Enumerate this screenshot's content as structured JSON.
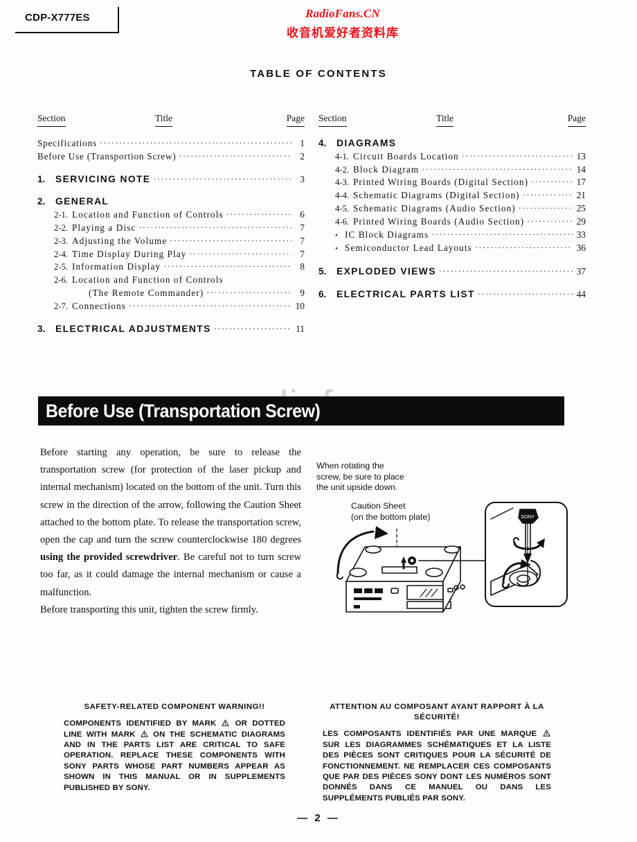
{
  "header": {
    "model": "CDP-X777ES",
    "brand_en": "RadioFans.CN",
    "brand_zh": "收音机爱好者资料库"
  },
  "toc": {
    "title": "TABLE OF CONTENTS",
    "columns": [
      {
        "headers": {
          "section": "Section",
          "title": "Title",
          "page": "Page"
        },
        "rows": [
          {
            "num": "",
            "label": "Specifications",
            "page": "1",
            "level": "plain"
          },
          {
            "num": "",
            "label": "Before Use (Transportion Screw)",
            "page": "2",
            "level": "plain"
          },
          {
            "num": "1.",
            "label": "SERVICING NOTE",
            "page": "3",
            "level": "lvl1",
            "gap": true
          },
          {
            "num": "2.",
            "label": "GENERAL",
            "page": "",
            "level": "lvl1",
            "gap": true,
            "nodots": true
          },
          {
            "num": "2-1.",
            "label": "Location and Function of Controls",
            "page": "6",
            "level": "lvl2"
          },
          {
            "num": "2-2.",
            "label": "Playing a Disc",
            "page": "7",
            "level": "lvl2"
          },
          {
            "num": "2-3.",
            "label": "Adjusting the Volume",
            "page": "7",
            "level": "lvl2"
          },
          {
            "num": "2-4.",
            "label": "Time Display During Play",
            "page": "7",
            "level": "lvl2"
          },
          {
            "num": "2-5.",
            "label": "Information Display",
            "page": "8",
            "level": "lvl2"
          },
          {
            "num": "2-6.",
            "label": "Location and Function of Controls",
            "page": "",
            "level": "lvl2",
            "nodots": true,
            "continuation": "(The Remote Commander)",
            "continuation_page": "9"
          },
          {
            "num": "2-7.",
            "label": "Connections",
            "page": "10",
            "level": "lvl2"
          },
          {
            "num": "3.",
            "label": "ELECTRICAL ADJUSTMENTS",
            "page": "11",
            "level": "lvl1",
            "gap": true
          }
        ]
      },
      {
        "headers": {
          "section": "Section",
          "title": "Title",
          "page": "Page"
        },
        "rows": [
          {
            "num": "4.",
            "label": "DIAGRAMS",
            "page": "",
            "level": "lvl1",
            "nodots": true
          },
          {
            "num": "4-1.",
            "label": "Circuit Boards Location",
            "page": "13",
            "level": "lvl2"
          },
          {
            "num": "4-2.",
            "label": "Block Diagram",
            "page": "14",
            "level": "lvl2"
          },
          {
            "num": "4-3.",
            "label": "Printed Wiring Boards (Digital Section)",
            "page": "17",
            "level": "lvl2"
          },
          {
            "num": "4-4.",
            "label": "Schematic Diagrams (Digital Section)",
            "page": "21",
            "level": "lvl2"
          },
          {
            "num": "4-5.",
            "label": "Schematic Diagrams (Audio Section)",
            "page": "25",
            "level": "lvl2"
          },
          {
            "num": "4-6.",
            "label": "Printed Wiring Boards (Audio Section)",
            "page": "29",
            "level": "lvl2"
          },
          {
            "num": "•",
            "label": "IC Block Diagrams",
            "page": "33",
            "level": "bullet"
          },
          {
            "num": "•",
            "label": "Semiconductor Lead Layouts",
            "page": "36",
            "level": "bullet"
          },
          {
            "num": "5.",
            "label": "EXPLODED VIEWS",
            "page": "37",
            "level": "lvl1",
            "gap": true
          },
          {
            "num": "6.",
            "label": "ELECTRICAL PARTS LIST",
            "page": "44",
            "level": "lvl1",
            "gap": true
          }
        ]
      }
    ]
  },
  "section": {
    "banner_title": "Before Use (Transportation Screw)",
    "watermark": "www.radiofans.cn",
    "paragraph_1": "Before starting any operation, be sure to release the transportation screw (for protection of the laser pickup and internal mechanism) located on the bottom of the unit. Turn this screw in the direction of the arrow, following the Caution Sheet attached to the bottom plate. To release the transportation screw, open the cap and turn the screw counterclockwise 180 degrees ",
    "paragraph_1_bold": "using the provided screwdriver",
    "paragraph_1_tail": ". Be careful not to turn screw too far, as it could damage the internal mechanism or cause a malfunction.",
    "paragraph_2": "Before transporting this unit, tighten the screw firmly."
  },
  "illustration": {
    "caption_rotate": "When rotating the\nscrew, be sure to place\nthe unit upside down.",
    "caption_sheet": "Caution Sheet\n(on the bottom plate)"
  },
  "warnings": {
    "left": {
      "heading": "SAFETY-RELATED COMPONENT WARNING!!",
      "body_a": "COMPONENTS IDENTIFIED BY MARK ",
      "body_b": " OR DOTTED LINE WITH MARK ",
      "body_c": " ON THE SCHEMATIC DIAGRAMS AND IN THE PARTS LIST ARE CRITICAL TO SAFE OPERATION.  REPLACE THESE COMPONENTS WITH SONY PARTS WHOSE PART NUMBERS APPEAR AS SHOWN IN THIS MANUAL OR IN SUPPLEMENTS PUBLISHED BY SONY."
    },
    "right": {
      "heading": "ATTENTION AU COMPOSANT AYANT RAPPORT À LA SÉCURITÉ!",
      "body_a": "LES COMPOSANTS IDENTIFIÉS PAR UNE MARQUE ",
      "body_b": " SUR LES DIAGRAMMES SCHÉMATIQUES ET LA LISTE DES PIÈCES SONT CRITIQUES POUR LA SÉCURITÉ DE FONCTIONNEMENT.  NE REMPLACER CES COMPOSANTS QUE PAR DES PIÈCES SONY DONT LES NUMÉROS SONT DONNÉS DANS CE MANUEL OU DANS LES SUPPLÉMENTS PUBLIÉS PAR SONY."
    }
  },
  "footer": {
    "page_number": "— 2 —"
  }
}
